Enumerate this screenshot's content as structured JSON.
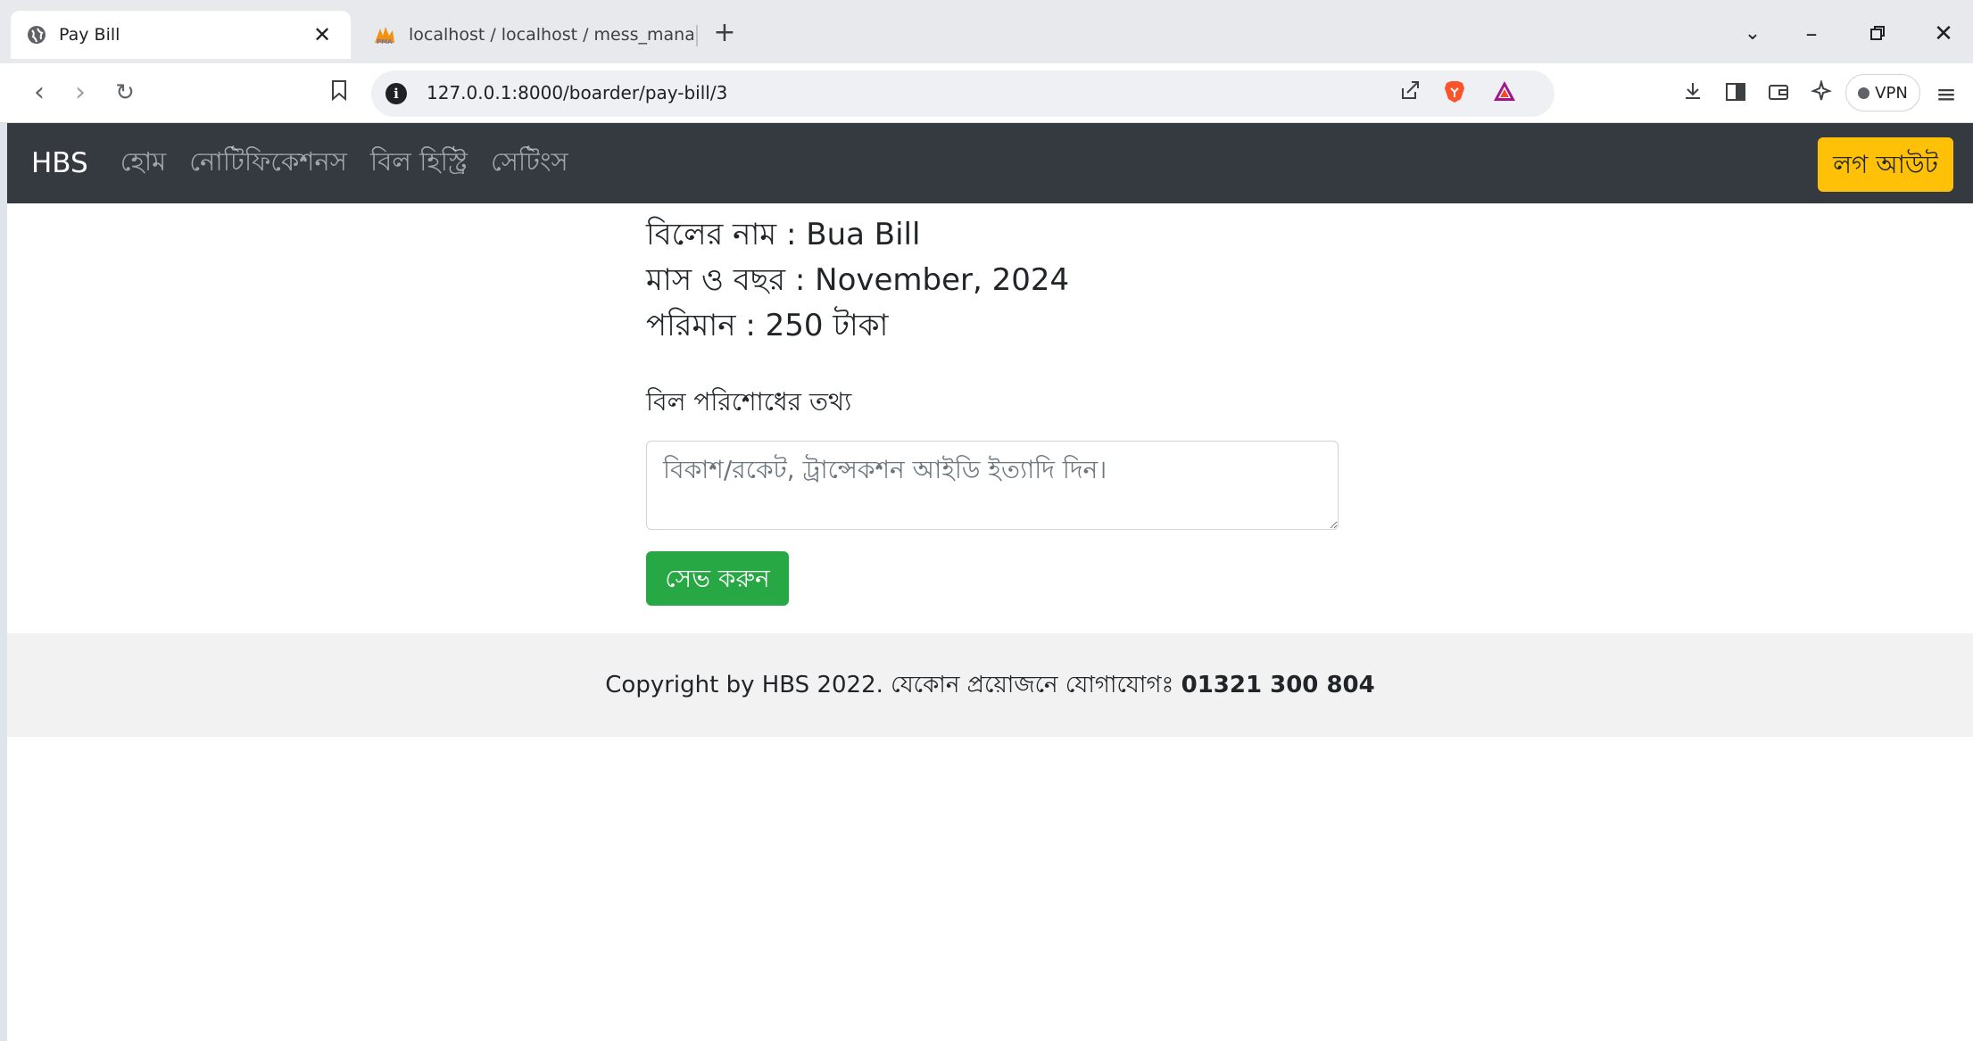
{
  "browser": {
    "tabs": [
      {
        "title": "Pay Bill",
        "icon": "globe-icon",
        "active": true
      },
      {
        "title": "localhost / localhost / mess_manage",
        "icon": "phpmyadmin-icon",
        "active": false
      }
    ],
    "url": "127.0.0.1:8000/boarder/pay-bill/3",
    "vpn_label": "VPN"
  },
  "navbar": {
    "brand": "HBS",
    "links": [
      "হোম",
      "নোটিফিকেশনস",
      "বিল হিস্ট্রি",
      "সেটিংস"
    ],
    "logout_label": "লগ আউট",
    "bg_color": "#343a40",
    "logout_color": "#ffc107"
  },
  "bill": {
    "name_line": "বিলের নাম : Bua Bill",
    "month_line": "মাস ও বছর : November, 2024",
    "amount_line": "পরিমান : 250 টাকা"
  },
  "form": {
    "label": "বিল পরিশোধের তথ্য",
    "placeholder": "বিকাশ/রকেট, ট্রান্সেকশন আইডি ইত্যাদি দিন।",
    "value": "",
    "save_label": "সেভ করুন",
    "save_color": "#28a745"
  },
  "footer": {
    "text": "Copyright by HBS 2022. যেকোন প্রয়োজনে যোগাযোগঃ ",
    "phone": "01321 300 804"
  }
}
